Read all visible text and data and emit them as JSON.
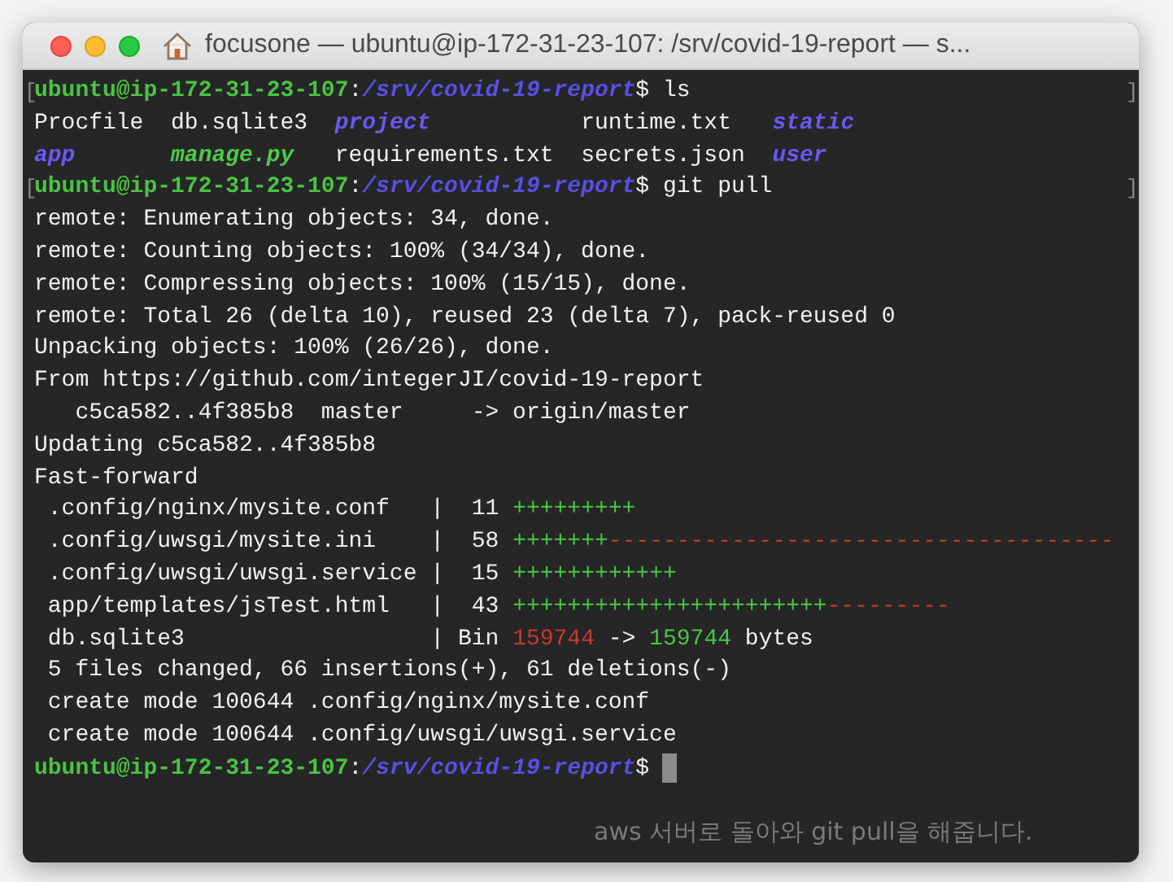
{
  "window": {
    "title": "focusone — ubuntu@ip-172-31-23-107: /srv/covid-19-report — s..."
  },
  "terminal_lines": [
    {
      "mark_left": "[",
      "mark_right": "]",
      "segments": [
        {
          "kind": "user",
          "text": "ubuntu@ip-172-31-23-107"
        },
        {
          "kind": "text",
          "text": ":"
        },
        {
          "kind": "path",
          "text": "/srv/covid-19-report"
        },
        {
          "kind": "text",
          "text": "$ ls"
        }
      ]
    },
    {
      "segments": [
        {
          "kind": "text",
          "text": "Procfile  db.sqlite3  "
        },
        {
          "kind": "dir",
          "text": "project"
        },
        {
          "kind": "text",
          "text": "           runtime.txt   "
        },
        {
          "kind": "dir",
          "text": "static"
        }
      ]
    },
    {
      "segments": [
        {
          "kind": "dir",
          "text": "app       "
        },
        {
          "kind": "exec",
          "text": "manage.py"
        },
        {
          "kind": "text",
          "text": "   requirements.txt  secrets.json  "
        },
        {
          "kind": "dir",
          "text": "user"
        }
      ]
    },
    {
      "mark_left": "[",
      "mark_right": "]",
      "segments": [
        {
          "kind": "user",
          "text": "ubuntu@ip-172-31-23-107"
        },
        {
          "kind": "text",
          "text": ":"
        },
        {
          "kind": "path",
          "text": "/srv/covid-19-report"
        },
        {
          "kind": "text",
          "text": "$ git pull"
        }
      ]
    },
    {
      "segments": [
        {
          "kind": "text",
          "text": "remote: Enumerating objects: 34, done."
        }
      ]
    },
    {
      "segments": [
        {
          "kind": "text",
          "text": "remote: Counting objects: 100% (34/34), done."
        }
      ]
    },
    {
      "segments": [
        {
          "kind": "text",
          "text": "remote: Compressing objects: 100% (15/15), done."
        }
      ]
    },
    {
      "segments": [
        {
          "kind": "text",
          "text": "remote: Total 26 (delta 10), reused 23 (delta 7), pack-reused 0"
        }
      ]
    },
    {
      "segments": [
        {
          "kind": "text",
          "text": "Unpacking objects: 100% (26/26), done."
        }
      ]
    },
    {
      "segments": [
        {
          "kind": "text",
          "text": "From https://github.com/integerJI/covid-19-report"
        }
      ]
    },
    {
      "segments": [
        {
          "kind": "text",
          "text": "   c5ca582..4f385b8  master     -> origin/master"
        }
      ]
    },
    {
      "segments": [
        {
          "kind": "text",
          "text": "Updating c5ca582..4f385b8"
        }
      ]
    },
    {
      "segments": [
        {
          "kind": "text",
          "text": "Fast-forward"
        }
      ]
    },
    {
      "segments": [
        {
          "kind": "text",
          "text": " .config/nginx/mysite.conf   |  11 "
        },
        {
          "kind": "added",
          "text": "+++++++++"
        }
      ]
    },
    {
      "segments": [
        {
          "kind": "text",
          "text": " .config/uwsgi/mysite.ini    |  58 "
        },
        {
          "kind": "added",
          "text": "+++++++"
        },
        {
          "kind": "removed",
          "text": "-------------------------------------"
        }
      ]
    },
    {
      "segments": [
        {
          "kind": "text",
          "text": " .config/uwsgi/uwsgi.service |  15 "
        },
        {
          "kind": "added",
          "text": "++++++++++++"
        }
      ]
    },
    {
      "segments": [
        {
          "kind": "text",
          "text": " app/templates/jsTest.html   |  43 "
        },
        {
          "kind": "added",
          "text": "+++++++++++++++++++++++"
        },
        {
          "kind": "removed",
          "text": "---------"
        }
      ]
    },
    {
      "segments": [
        {
          "kind": "text",
          "text": " db.sqlite3                  | Bin "
        },
        {
          "kind": "removed",
          "text": "159744"
        },
        {
          "kind": "text",
          "text": " -> "
        },
        {
          "kind": "added",
          "text": "159744"
        },
        {
          "kind": "text",
          "text": " bytes"
        }
      ]
    },
    {
      "segments": [
        {
          "kind": "text",
          "text": " 5 files changed, 66 insertions(+), 61 deletions(-)"
        }
      ]
    },
    {
      "segments": [
        {
          "kind": "text",
          "text": " create mode 100644 .config/nginx/mysite.conf"
        }
      ]
    },
    {
      "segments": [
        {
          "kind": "text",
          "text": " create mode 100644 .config/uwsgi/uwsgi.service"
        }
      ]
    },
    {
      "segments": [
        {
          "kind": "user",
          "text": "ubuntu@ip-172-31-23-107"
        },
        {
          "kind": "text",
          "text": ":"
        },
        {
          "kind": "path",
          "text": "/srv/covid-19-report"
        },
        {
          "kind": "text",
          "text": "$ "
        },
        {
          "kind": "cursor"
        }
      ]
    }
  ],
  "background_text": "aws 서버로 돌아와 git pull을 해줍니다."
}
